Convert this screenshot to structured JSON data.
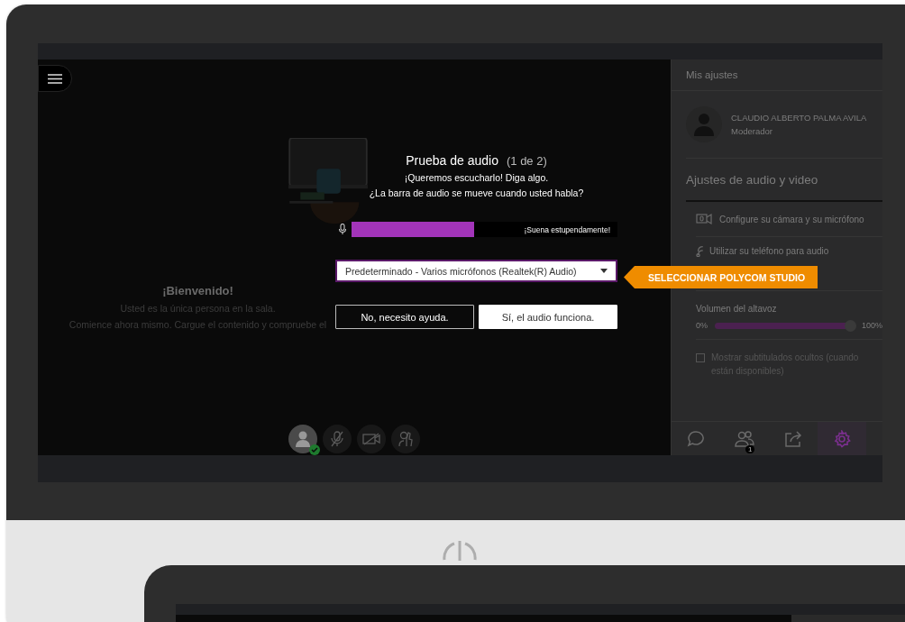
{
  "stage": {
    "welcome_title": "¡Bienvenido!",
    "welcome_lines": [
      "Usted es la única persona en la sala.",
      "Comience ahora mismo. Cargue el contenido y compruebe el"
    ]
  },
  "dialog": {
    "title": "Prueba de audio",
    "step": "(1 de 2)",
    "lines": [
      "¡Queremos escucharlo! Diga algo.",
      "¿La barra de audio se mueve cuando usted habla?"
    ],
    "meter": {
      "level": 0.46,
      "reading": "¡Suena estupendamente!"
    },
    "device_select": {
      "value": "Predeterminado - Varios micrófonos (Realtek(R) Audio)"
    },
    "buttons": [
      {
        "label": "No, necesito ayuda.",
        "kind": "outline"
      },
      {
        "label": "Sí, el audio funciona.",
        "kind": "primary"
      }
    ]
  },
  "callout": {
    "text": "SELECCIONAR POLYCOM STUDIO"
  },
  "panel": {
    "title": "Mis ajustes",
    "user": {
      "name": "CLAUDIO ALBERTO PALMA AVILA",
      "role": "Moderador"
    },
    "section_title": "Ajustes de audio y video",
    "items": [
      {
        "kind": "camera",
        "label": "Configure su cámara y su micrófono"
      },
      {
        "kind": "phone",
        "label": "Utilizar su teléfono para audio"
      }
    ],
    "volume": {
      "label": "Volumen del altavoz",
      "min": "0%",
      "max": "100%",
      "level": 0.97
    },
    "captions": {
      "label": "Mostrar subtitulados ocultos (cuando están disponibles)",
      "checked": false
    },
    "tabs": [
      {
        "kind": "chat",
        "selected": false
      },
      {
        "kind": "people",
        "selected": false,
        "badge": "1"
      },
      {
        "kind": "share",
        "selected": false
      },
      {
        "kind": "settings",
        "selected": true
      }
    ]
  }
}
